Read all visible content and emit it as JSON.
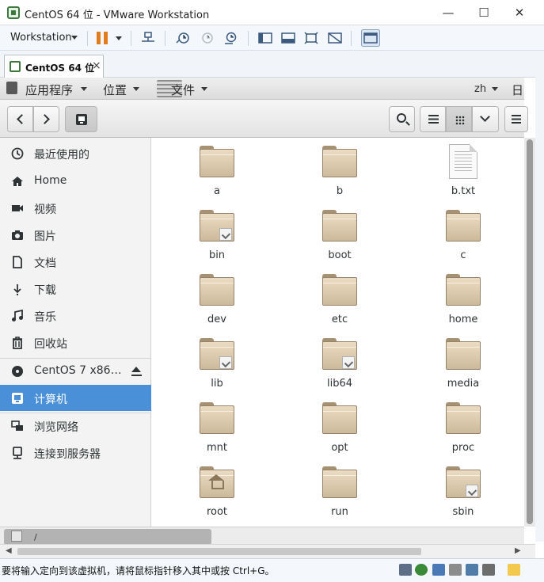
{
  "window": {
    "title": "CentOS 64 位 - VMware Workstation",
    "minimize_glyph": "—",
    "maximize_glyph": "☐",
    "close_glyph": "✕"
  },
  "vmware_toolbar": {
    "menu_label": "Workstation"
  },
  "vm_tab": {
    "label": "CentOS 64 位",
    "close_glyph": "×"
  },
  "gnome_topbar": {
    "applications": "应用程序",
    "places": "位置",
    "files": "文件",
    "input_method": "zh",
    "date_fragment": "日"
  },
  "sidebar": {
    "items": [
      {
        "label": "最近使用的",
        "icon": "clock-icon"
      },
      {
        "label": "Home",
        "icon": "home-icon"
      },
      {
        "label": "视频",
        "icon": "video-icon"
      },
      {
        "label": "图片",
        "icon": "camera-icon"
      },
      {
        "label": "文档",
        "icon": "document-icon"
      },
      {
        "label": "下载",
        "icon": "download-icon"
      },
      {
        "label": "音乐",
        "icon": "music-icon"
      },
      {
        "label": "回收站",
        "icon": "trash-icon"
      }
    ],
    "devices": [
      {
        "label": "CentOS 7 x86…",
        "icon": "disc-icon"
      },
      {
        "label": "计算机",
        "icon": "computer-icon",
        "selected": true
      }
    ],
    "network": [
      {
        "label": "浏览网络",
        "icon": "network-icon"
      },
      {
        "label": "连接到服务器",
        "icon": "server-icon"
      }
    ]
  },
  "files": [
    {
      "name": "a",
      "type": "folder"
    },
    {
      "name": "b",
      "type": "folder"
    },
    {
      "name": "b.txt",
      "type": "text"
    },
    {
      "name": "bin",
      "type": "folder-link"
    },
    {
      "name": "boot",
      "type": "folder"
    },
    {
      "name": "c",
      "type": "folder"
    },
    {
      "name": "dev",
      "type": "folder"
    },
    {
      "name": "etc",
      "type": "folder"
    },
    {
      "name": "home",
      "type": "folder"
    },
    {
      "name": "lib",
      "type": "folder-link"
    },
    {
      "name": "lib64",
      "type": "folder-link"
    },
    {
      "name": "media",
      "type": "folder"
    },
    {
      "name": "mnt",
      "type": "folder"
    },
    {
      "name": "opt",
      "type": "folder"
    },
    {
      "name": "proc",
      "type": "folder"
    },
    {
      "name": "root",
      "type": "folder-home"
    },
    {
      "name": "run",
      "type": "folder"
    },
    {
      "name": "sbin",
      "type": "folder-link"
    }
  ],
  "bottom_path": "/",
  "status_message": "要将输入定向到该虚拟机，请将鼠标指针移入其中或按 Ctrl+G。",
  "colors": {
    "selection": "#4a90d9",
    "folder": "#d9c8a8",
    "pause": "#e27b1c"
  }
}
